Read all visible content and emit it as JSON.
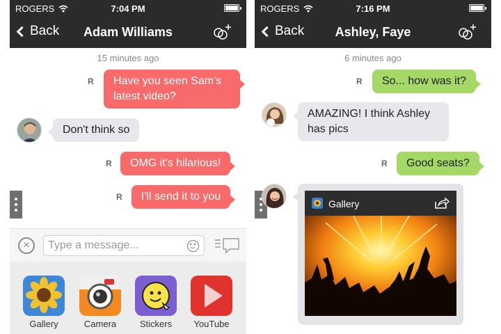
{
  "left": {
    "status": {
      "carrier": "ROGERS",
      "time": "7:04 PM"
    },
    "nav": {
      "back_label": "Back",
      "title": "Adam Williams"
    },
    "timestamp": "15 minutes ago",
    "messages": [
      {
        "text": "Have you seen Sam's latest video?",
        "direction": "outgoing",
        "receipt": "R"
      },
      {
        "text": "Don't think so",
        "direction": "incoming"
      },
      {
        "text": "OMG it's hilarious!",
        "direction": "outgoing",
        "receipt": "R"
      },
      {
        "text": "I'll send it to you",
        "direction": "outgoing",
        "receipt": "R"
      }
    ],
    "input": {
      "placeholder": "Type a message..."
    },
    "apps": [
      {
        "label": "Gallery",
        "icon": "sunflower-icon"
      },
      {
        "label": "Camera",
        "icon": "camera-icon"
      },
      {
        "label": "Stickers",
        "icon": "sticker-face-icon"
      },
      {
        "label": "YouTube",
        "icon": "play-icon"
      }
    ]
  },
  "right": {
    "status": {
      "carrier": "ROGERS",
      "time": "7:16 PM"
    },
    "nav": {
      "back_label": "Back",
      "title": "Ashley, Faye"
    },
    "timestamp": "6 minutes ago",
    "messages": [
      {
        "text": "So... how was it?",
        "direction": "outgoing",
        "receipt": "R"
      },
      {
        "text": "AMAZING! I think Ashley has pics",
        "direction": "incoming"
      },
      {
        "text": "Good seats?",
        "direction": "outgoing",
        "receipt": "R"
      }
    ],
    "gallery_card": {
      "title": "Gallery",
      "icon": "gallery-icon",
      "action_icon": "share-icon"
    }
  },
  "colors": {
    "bar": "#2b2b2b",
    "outgoing_red": "#f96b6b",
    "outgoing_green": "#a5d867",
    "incoming": "#e7e7ec"
  }
}
